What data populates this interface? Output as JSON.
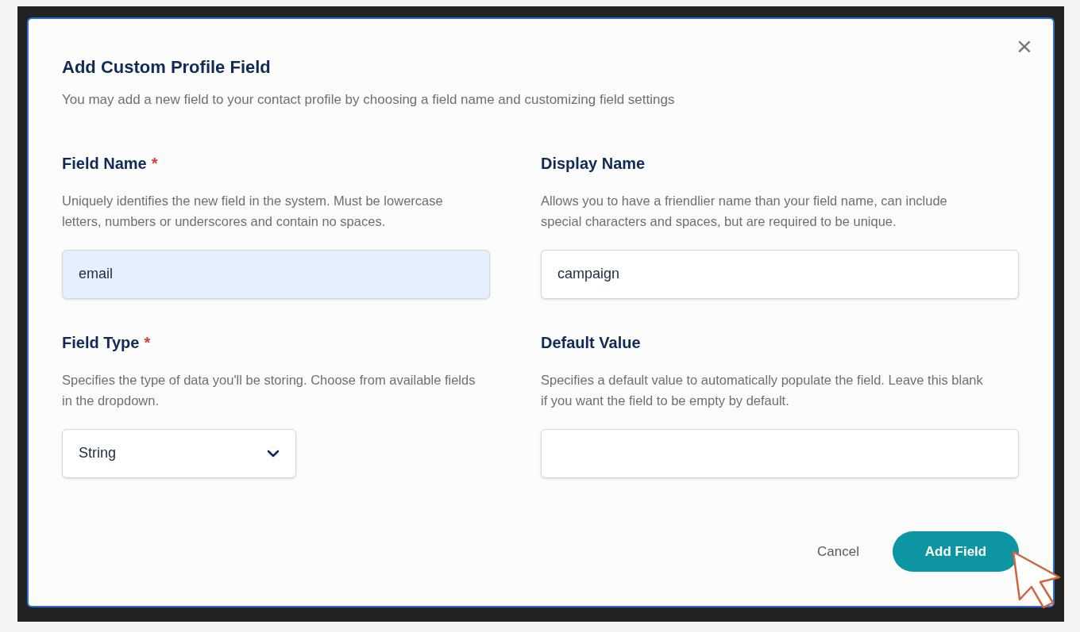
{
  "dialog": {
    "title": "Add Custom Profile Field",
    "subtitle": "You may add a new field to your contact profile by choosing a field name and customizing field settings",
    "close": "×"
  },
  "fields": [
    {
      "kind": "text",
      "label": "Field Name",
      "required_mark": "*",
      "description": "Uniquely identifies the new field in the system. Must be lowercase letters, numbers or underscores and contain no spaces.",
      "value": "email",
      "highlighted": true
    },
    {
      "kind": "text",
      "label": "Display Name",
      "description": "Allows you to have a friendlier name than your field name, can include special characters and spaces, but are required to be unique.",
      "value": "campaign",
      "highlighted": false
    },
    {
      "kind": "select",
      "label": "Field Type",
      "required_mark": "*",
      "description": "Specifies the type of data you'll be storing. Choose from available fields in the dropdown.",
      "value": "String",
      "highlighted": false
    },
    {
      "kind": "text",
      "label": "Default Value",
      "description": "Specifies a default value to automatically populate the field. Leave this blank if you want the field to be empty by default.",
      "highlighted": false
    }
  ],
  "buttons": [
    {
      "kind": "secondary",
      "label": "Cancel"
    },
    {
      "kind": "primary",
      "label": "Add Field"
    }
  ]
}
